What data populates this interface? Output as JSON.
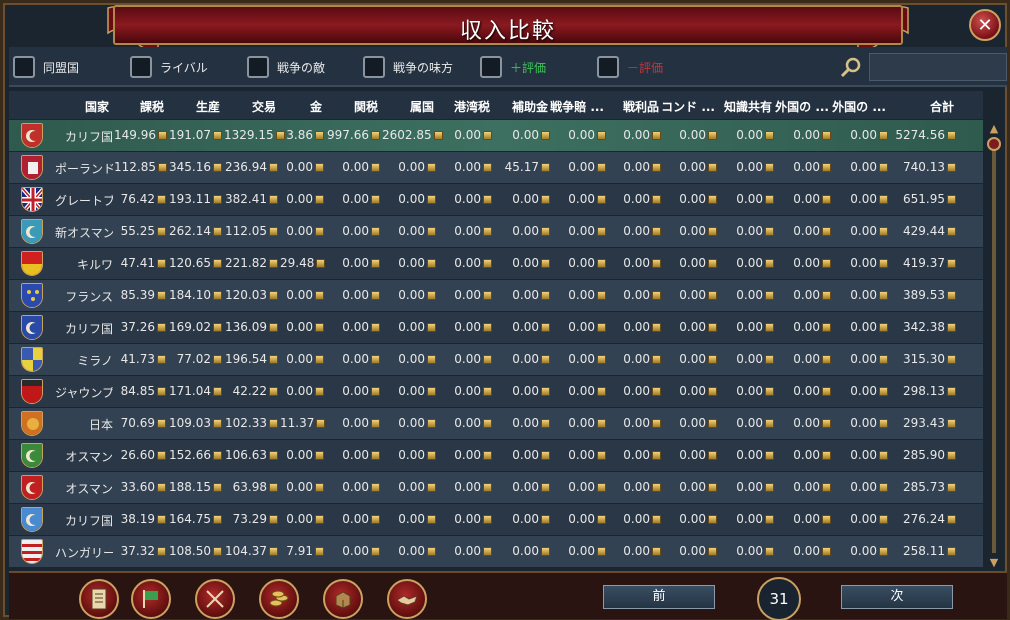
{
  "window": {
    "title": "収入比較",
    "close_label": "✕"
  },
  "filters": [
    {
      "label": "同盟国",
      "type": "normal"
    },
    {
      "label": "ライバル",
      "type": "normal"
    },
    {
      "label": "戦争の敵",
      "type": "normal"
    },
    {
      "label": "戦争の味方",
      "type": "normal"
    },
    {
      "label": "＋評価",
      "type": "pos"
    },
    {
      "label": "－評価",
      "type": "neg"
    }
  ],
  "search": {
    "value": "",
    "placeholder": ""
  },
  "columns": [
    "国家",
    "課税",
    "生産",
    "交易",
    "金",
    "関税",
    "属国",
    "港湾税",
    "補助金",
    "戦争賠 ...",
    "戦利品",
    "コンド ...",
    "知識共有",
    "外国の ...",
    "外国の ...",
    "合計"
  ],
  "rows": [
    {
      "name": "カリフ国",
      "flag": "crescent-green",
      "values": [
        "149.96",
        "191.07",
        "1329.15",
        "3.86",
        "997.66",
        "2602.85",
        "0.00",
        "0.00",
        "0.00",
        "0.00",
        "0.00",
        "0.00",
        "0.00",
        "0.00"
      ],
      "total": "5274.56",
      "selected": true
    },
    {
      "name": "ポーランド",
      "flag": "poland",
      "values": [
        "112.85",
        "345.16",
        "236.94",
        "0.00",
        "0.00",
        "0.00",
        "0.00",
        "45.17",
        "0.00",
        "0.00",
        "0.00",
        "0.00",
        "0.00",
        "0.00"
      ],
      "total": "740.13"
    },
    {
      "name": "グレートブリテン",
      "flag": "union-jack",
      "values": [
        "76.42",
        "193.11",
        "382.41",
        "0.00",
        "0.00",
        "0.00",
        "0.00",
        "0.00",
        "0.00",
        "0.00",
        "0.00",
        "0.00",
        "0.00",
        "0.00"
      ],
      "total": "651.95"
    },
    {
      "name": "新オスマン",
      "flag": "crescent-cyan",
      "values": [
        "55.25",
        "262.14",
        "112.05",
        "0.00",
        "0.00",
        "0.00",
        "0.00",
        "0.00",
        "0.00",
        "0.00",
        "0.00",
        "0.00",
        "0.00",
        "0.00"
      ],
      "total": "429.44"
    },
    {
      "name": "キルワ",
      "flag": "kilwa",
      "values": [
        "47.41",
        "120.65",
        "221.82",
        "29.48",
        "0.00",
        "0.00",
        "0.00",
        "0.00",
        "0.00",
        "0.00",
        "0.00",
        "0.00",
        "0.00",
        "0.00"
      ],
      "total": "419.37"
    },
    {
      "name": "フランス",
      "flag": "france",
      "values": [
        "85.39",
        "184.10",
        "120.03",
        "0.00",
        "0.00",
        "0.00",
        "0.00",
        "0.00",
        "0.00",
        "0.00",
        "0.00",
        "0.00",
        "0.00",
        "0.00"
      ],
      "total": "389.53"
    },
    {
      "name": "カリフ国",
      "flag": "crescent-blue",
      "values": [
        "37.26",
        "169.02",
        "136.09",
        "0.00",
        "0.00",
        "0.00",
        "0.00",
        "0.00",
        "0.00",
        "0.00",
        "0.00",
        "0.00",
        "0.00",
        "0.00"
      ],
      "total": "342.38"
    },
    {
      "name": "ミラノ",
      "flag": "milan",
      "values": [
        "41.73",
        "77.02",
        "196.54",
        "0.00",
        "0.00",
        "0.00",
        "0.00",
        "0.00",
        "0.00",
        "0.00",
        "0.00",
        "0.00",
        "0.00",
        "0.00"
      ],
      "total": "315.30"
    },
    {
      "name": "ジャウンプル",
      "flag": "red-flag",
      "values": [
        "84.85",
        "171.04",
        "42.22",
        "0.00",
        "0.00",
        "0.00",
        "0.00",
        "0.00",
        "0.00",
        "0.00",
        "0.00",
        "0.00",
        "0.00",
        "0.00"
      ],
      "total": "298.13"
    },
    {
      "name": "日本",
      "flag": "japan",
      "values": [
        "70.69",
        "109.03",
        "102.33",
        "11.37",
        "0.00",
        "0.00",
        "0.00",
        "0.00",
        "0.00",
        "0.00",
        "0.00",
        "0.00",
        "0.00",
        "0.00"
      ],
      "total": "293.43"
    },
    {
      "name": "オスマン",
      "flag": "crescent-green2",
      "values": [
        "26.60",
        "152.66",
        "106.63",
        "0.00",
        "0.00",
        "0.00",
        "0.00",
        "0.00",
        "0.00",
        "0.00",
        "0.00",
        "0.00",
        "0.00",
        "0.00"
      ],
      "total": "285.90"
    },
    {
      "name": "オスマン",
      "flag": "crescent-red",
      "values": [
        "33.60",
        "188.15",
        "63.98",
        "0.00",
        "0.00",
        "0.00",
        "0.00",
        "0.00",
        "0.00",
        "0.00",
        "0.00",
        "0.00",
        "0.00",
        "0.00"
      ],
      "total": "285.73"
    },
    {
      "name": "カリフ国",
      "flag": "crescent-lblue",
      "values": [
        "38.19",
        "164.75",
        "73.29",
        "0.00",
        "0.00",
        "0.00",
        "0.00",
        "0.00",
        "0.00",
        "0.00",
        "0.00",
        "0.00",
        "0.00",
        "0.00"
      ],
      "total": "276.24"
    },
    {
      "name": "ハンガリー",
      "flag": "hungary",
      "values": [
        "37.32",
        "108.50",
        "104.37",
        "7.91",
        "0.00",
        "0.00",
        "0.00",
        "0.00",
        "0.00",
        "0.00",
        "0.00",
        "0.00",
        "0.00",
        "0.00"
      ],
      "total": "258.11"
    }
  ],
  "footer": {
    "icons": [
      "ledger-icon",
      "flag-icon",
      "swords-icon",
      "coins-icon",
      "trade-icon",
      "diplomacy-icon"
    ],
    "prev_label": "前",
    "next_label": "次",
    "page": "31"
  },
  "colors": {
    "accent_gold": "#c9a262",
    "title_red": "#8a1a20",
    "row_odd": "#2a3746",
    "row_even": "#334252",
    "selected_row": "#3d7060",
    "positive": "#3fc45a",
    "negative": "#c8343a"
  }
}
